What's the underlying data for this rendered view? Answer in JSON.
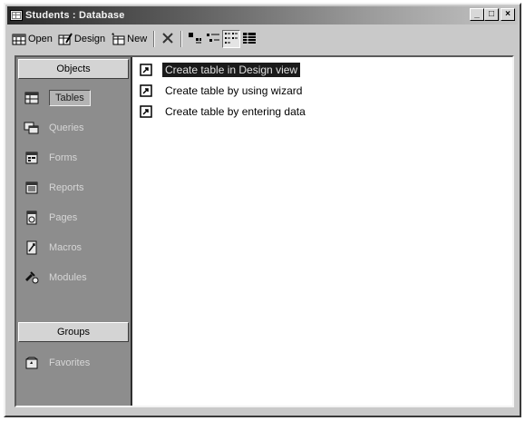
{
  "window": {
    "title": "Students : Database",
    "minimize_glyph": "_",
    "maximize_glyph": "□",
    "close_glyph": "×"
  },
  "toolbar": {
    "open_label": "Open",
    "design_label": "Design",
    "new_label": "New"
  },
  "objects_bar": {
    "objects_header": "Objects",
    "groups_header": "Groups",
    "items": [
      {
        "label": "Tables",
        "icon": "table-icon",
        "selected": true
      },
      {
        "label": "Queries",
        "icon": "query-icon",
        "selected": false
      },
      {
        "label": "Forms",
        "icon": "form-icon",
        "selected": false
      },
      {
        "label": "Reports",
        "icon": "report-icon",
        "selected": false
      },
      {
        "label": "Pages",
        "icon": "page-icon",
        "selected": false
      },
      {
        "label": "Macros",
        "icon": "macro-icon",
        "selected": false
      },
      {
        "label": "Modules",
        "icon": "module-icon",
        "selected": false
      }
    ],
    "groups": [
      {
        "label": "Favorites",
        "icon": "favorites-icon"
      }
    ]
  },
  "list": {
    "items": [
      {
        "label": "Create table in Design view",
        "selected": true
      },
      {
        "label": "Create table by using wizard",
        "selected": false
      },
      {
        "label": "Create table by entering data",
        "selected": false
      }
    ]
  }
}
